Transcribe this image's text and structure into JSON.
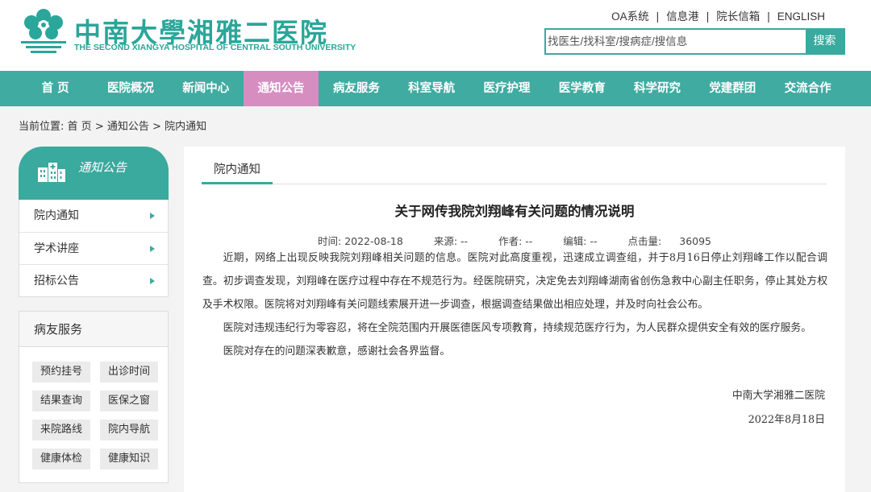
{
  "header": {
    "logo_cn": "中南大學湘雅二医院",
    "logo_en": "THE SECOND XIANGYA HOSPITAL OF CENTRAL SOUTH UNIVERSITY",
    "top_links": [
      "OA系统",
      "信息港",
      "院长信箱",
      "ENGLISH"
    ],
    "search": {
      "placeholder": "找医生/找科室/搜病症/搜信息",
      "button": "搜索"
    }
  },
  "colors": {
    "brand": "#40aba1",
    "active_nav": "#d68ec1"
  },
  "nav": {
    "items": [
      "首 页",
      "医院概况",
      "新闻中心",
      "通知公告",
      "病友服务",
      "科室导航",
      "医疗护理",
      "医学教育",
      "科学研究",
      "党建群团",
      "交流合作"
    ],
    "active_index": 3
  },
  "breadcrumb": {
    "prefix": "当前位置:",
    "items": [
      "首 页",
      "通知公告",
      "院内通知"
    ],
    "separator": ">"
  },
  "sidebar": {
    "title": "通知公告",
    "icon": "hospital-building-icon",
    "items": [
      "院内通知",
      "学术讲座",
      "招标公告"
    ],
    "service_title": "病友服务",
    "services": [
      "预约挂号",
      "出诊时间",
      "结果查询",
      "医保之窗",
      "来院路线",
      "院内导航",
      "健康体检",
      "健康知识"
    ]
  },
  "article": {
    "tab": "院内通知",
    "title": "关于网传我院刘翔峰有关问题的情况说明",
    "meta": {
      "time_label": "时间:",
      "time": "2022-08-18",
      "source_label": "来源:",
      "source": "--",
      "author_label": "作者:",
      "author": "--",
      "editor_label": "编辑:",
      "editor": "--",
      "clicks_label": "点击量:",
      "clicks": "36095"
    },
    "paragraphs": [
      "近期，网络上出现反映我院刘翔峰相关问题的信息。医院对此高度重视，迅速成立调查组，并于8月16日停止刘翔峰工作以配合调查。初步调查发现，刘翔峰在医疗过程中存在不规范行为。经医院研究，决定免去刘翔峰湖南省创伤急救中心副主任职务，停止其处方权及手术权限。医院将对刘翔峰有关问题线索展开进一步调查，根据调查结果做出相应处理，并及时向社会公布。",
      "医院对违规违纪行为零容忍，将在全院范围内开展医德医风专项教育，持续规范医疗行为，为人民群众提供安全有效的医疗服务。",
      "医院对存在的问题深表歉意，感谢社会各界监督。"
    ],
    "signature": "中南大学湘雅二医院",
    "date": "2022年8月18日"
  }
}
